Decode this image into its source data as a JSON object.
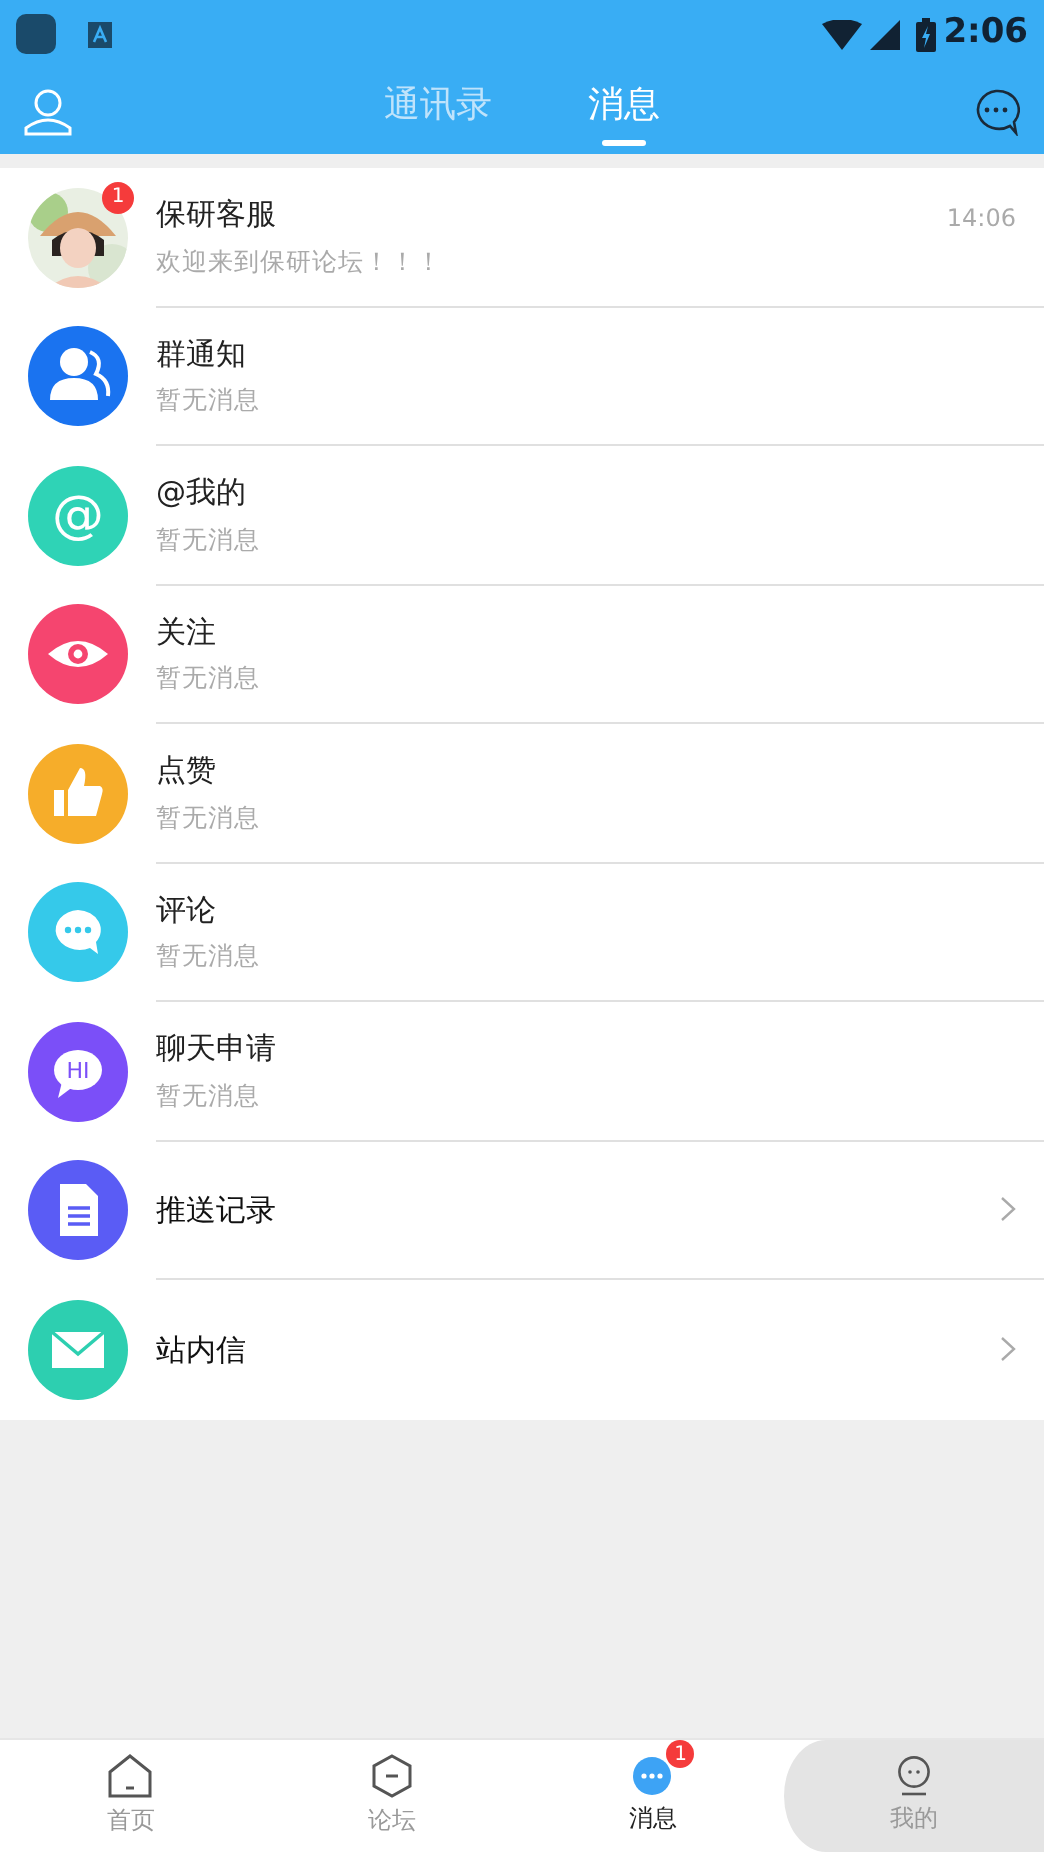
{
  "status_bar": {
    "time": "2:06"
  },
  "header": {
    "tabs": [
      {
        "label": "通讯录",
        "selected": false
      },
      {
        "label": "消息",
        "selected": true
      }
    ]
  },
  "conversations": [
    {
      "kind": "chat",
      "badge": "1",
      "title": "保研客服",
      "subtitle": "欢迎来到保研论坛！！！",
      "time": "14:06"
    },
    {
      "kind": "chat",
      "color": "#1a73f0",
      "title": "群通知",
      "subtitle": "暂无消息"
    },
    {
      "kind": "chat",
      "icon_text": "@",
      "color": "#2fd3b6",
      "title": "@我的",
      "subtitle": "暂无消息"
    },
    {
      "kind": "chat",
      "color": "#f5456f",
      "title": "关注",
      "subtitle": "暂无消息"
    },
    {
      "kind": "chat",
      "color": "#f6ad2a",
      "title": "点赞",
      "subtitle": "暂无消息"
    },
    {
      "kind": "chat",
      "color": "#35c9ea",
      "title": "评论",
      "subtitle": "暂无消息"
    },
    {
      "kind": "chat",
      "icon_text": "HI",
      "color": "#7b4ff8",
      "title": "聊天申请",
      "subtitle": "暂无消息"
    },
    {
      "kind": "link",
      "color": "#5a5cf5",
      "title": "推送记录"
    },
    {
      "kind": "link",
      "color": "#2dcfb0",
      "title": "站内信"
    }
  ],
  "bottom_nav": [
    {
      "label": "首页",
      "selected": false,
      "pressed": false
    },
    {
      "label": "论坛",
      "selected": false,
      "pressed": false
    },
    {
      "label": "消息",
      "badge": "1",
      "selected": true,
      "pressed": false
    },
    {
      "label": "我的",
      "selected": false,
      "pressed": true
    }
  ]
}
